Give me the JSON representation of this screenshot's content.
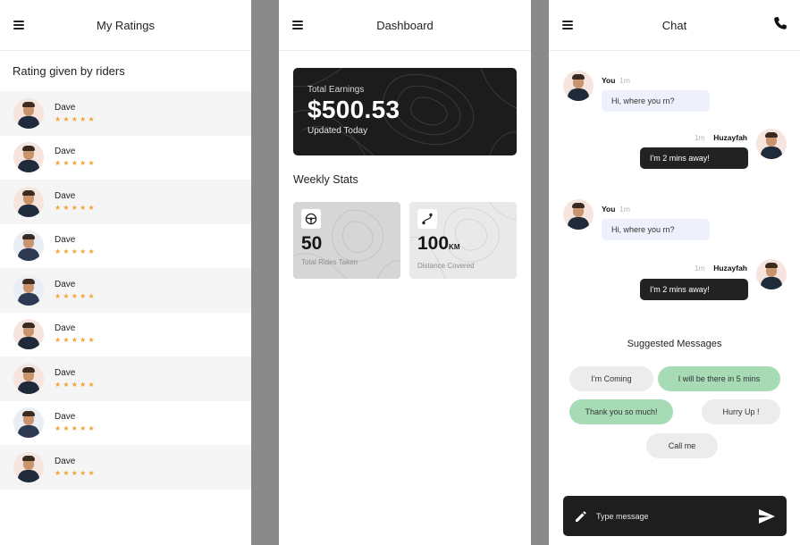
{
  "ratings": {
    "title": "My Ratings",
    "section": "Rating given by riders",
    "items": [
      {
        "name": "Dave",
        "stars": "★★★★★"
      },
      {
        "name": "Dave",
        "stars": "★★★★★"
      },
      {
        "name": "Dave",
        "stars": "★★★★★"
      },
      {
        "name": "Dave",
        "stars": "★★★★★"
      },
      {
        "name": "Dave",
        "stars": "★★★★★"
      },
      {
        "name": "Dave",
        "stars": "★★★★★"
      },
      {
        "name": "Dave",
        "stars": "★★★★★"
      },
      {
        "name": "Dave",
        "stars": "★★★★★"
      },
      {
        "name": "Dave",
        "stars": "★★★★★"
      }
    ]
  },
  "dashboard": {
    "title": "Dashboard",
    "earnings_label": "Total Earnings",
    "earnings_value": "$500.53",
    "earnings_sub": "Updated Today",
    "weekly_title": "Weekly Stats",
    "rides_value": "50",
    "rides_label": "Total Rides Taken",
    "distance_value": "100",
    "distance_unit": "KM",
    "distance_label": "Distance Covered"
  },
  "chat": {
    "title": "Chat",
    "messages": [
      {
        "sender": "You",
        "time": "1m",
        "text": "Hi, where you rn?"
      },
      {
        "sender": "Huzayfah",
        "time": "1m",
        "text": "I'm 2 mins away!"
      },
      {
        "sender": "You",
        "time": "1m",
        "text": "Hi, where you rn?"
      },
      {
        "sender": "Huzayfah",
        "time": "1m",
        "text": "I'm 2 mins away!"
      }
    ],
    "suggested_title": "Suggested Messages",
    "suggestions": [
      "I'm Coming",
      "I will be there in 5 mins",
      "Thank you so much!",
      "Hurry Up !",
      "Call me"
    ],
    "input_placeholder": "Type message"
  },
  "colors": {
    "accent_star": "#f2a33a",
    "dark": "#1e1e1e",
    "suggestion_green": "#a6dbb5",
    "bubble_in": "#eef1fb",
    "gutter": "#8a8a8a"
  },
  "icons": [
    "menu-icon",
    "phone-icon",
    "steering-wheel-icon",
    "route-icon",
    "pencil-icon",
    "send-icon"
  ]
}
